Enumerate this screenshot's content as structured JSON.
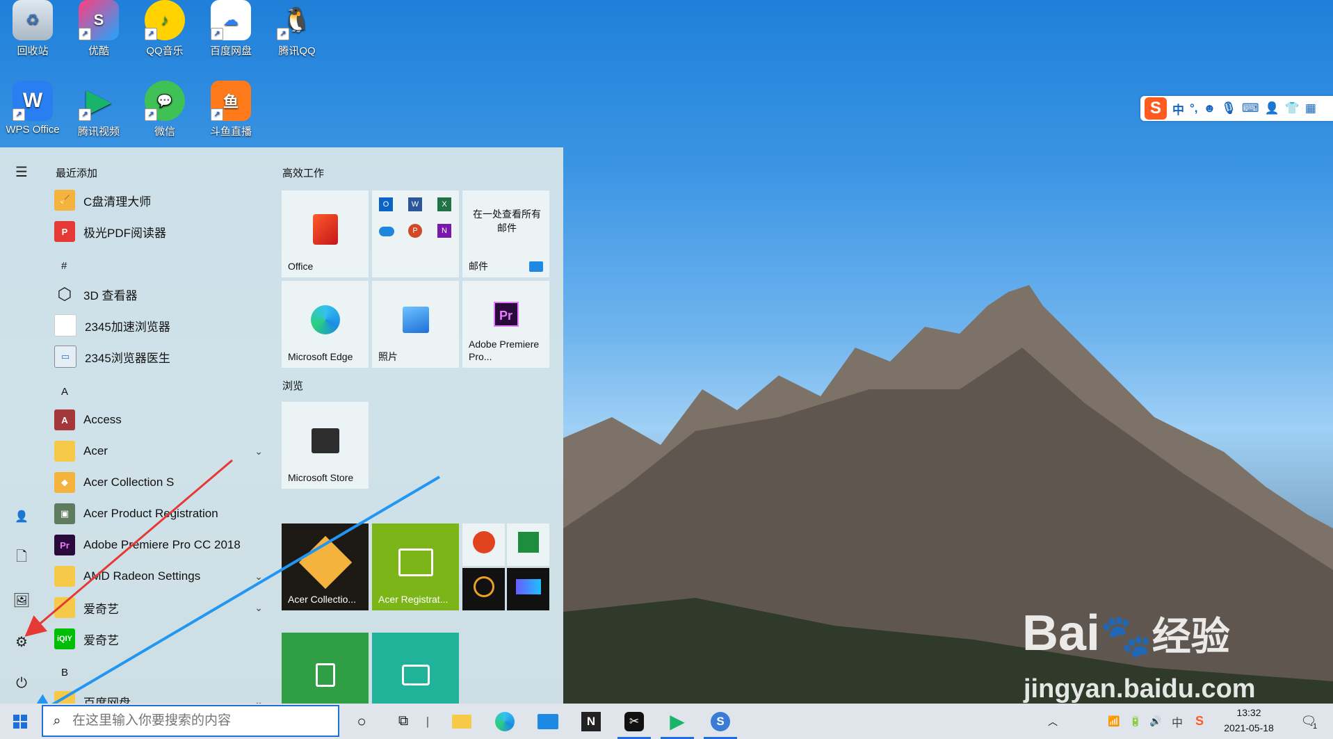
{
  "desktop": {
    "icons": [
      {
        "label": "回收站",
        "icon": "recycle-bin-icon"
      },
      {
        "label": "优酷",
        "icon": "youku-icon"
      },
      {
        "label": "QQ音乐",
        "icon": "qq-music-icon"
      },
      {
        "label": "百度网盘",
        "icon": "baidu-netdisk-icon"
      },
      {
        "label": "腾讯QQ",
        "icon": "qq-icon"
      },
      {
        "label": "WPS Office",
        "icon": "wps-icon"
      },
      {
        "label": "腾讯视频",
        "icon": "tencent-video-icon"
      },
      {
        "label": "微信",
        "icon": "wechat-icon"
      },
      {
        "label": "斗鱼直播",
        "icon": "douyu-icon"
      }
    ]
  },
  "ime_bar": {
    "mode": "中",
    "punct": "°,"
  },
  "start_menu": {
    "recent_header": "最近添加",
    "apps": [
      {
        "label": "C盘清理大师",
        "icon": "broom-icon"
      },
      {
        "label": "极光PDF阅读器",
        "icon": "pdf-icon"
      },
      {
        "label": "#",
        "group": true
      },
      {
        "label": "3D 查看器",
        "icon": "cube-icon"
      },
      {
        "label": "2345加速浏览器",
        "icon": "browser-icon"
      },
      {
        "label": "2345浏览器医生",
        "icon": "browser-doctor-icon"
      },
      {
        "label": "A",
        "group": true
      },
      {
        "label": "Access",
        "icon": "access-icon"
      },
      {
        "label": "Acer",
        "icon": "folder-icon",
        "expand": true
      },
      {
        "label": "Acer Collection S",
        "icon": "acer-collection-icon"
      },
      {
        "label": "Acer Product Registration",
        "icon": "acer-registration-icon"
      },
      {
        "label": "Adobe Premiere Pro CC 2018",
        "icon": "premiere-icon"
      },
      {
        "label": "AMD Radeon Settings",
        "icon": "folder-icon",
        "expand": true
      },
      {
        "label": "爱奇艺",
        "icon": "folder-icon",
        "expand": true
      },
      {
        "label": "爱奇艺",
        "icon": "iqiyi-icon"
      },
      {
        "label": "B",
        "group": true
      },
      {
        "label": "百度网盘",
        "icon": "folder-icon",
        "expand": true
      }
    ],
    "tile_sections": {
      "productivity": "高效工作",
      "browse": "浏览"
    },
    "tiles": {
      "office": "Office",
      "mail_text": "在一处查看所有邮件",
      "mail_label": "邮件",
      "edge": "Microsoft Edge",
      "photos": "照片",
      "premiere": "Adobe Premiere Pro...",
      "store": "Microsoft Store",
      "acer_collection": "Acer Collectio...",
      "acer_registration": "Acer Registrat..."
    },
    "rail": [
      "menu-icon",
      "user-icon",
      "document-icon",
      "pictures-icon",
      "settings-icon",
      "power-icon"
    ]
  },
  "taskbar": {
    "search_placeholder": "在这里输入你要搜索的内容",
    "time": "13:32",
    "date": "2021-05-18",
    "ime_indicator": "中",
    "notification_count": "1"
  },
  "watermark": {
    "brand": "Bai",
    "brand_tail": "经验",
    "url": "jingyan.baidu.com"
  },
  "colors": {
    "accent": "#1e6fd9",
    "arrow_red": "#e53935",
    "arrow_blue": "#2196f3"
  }
}
